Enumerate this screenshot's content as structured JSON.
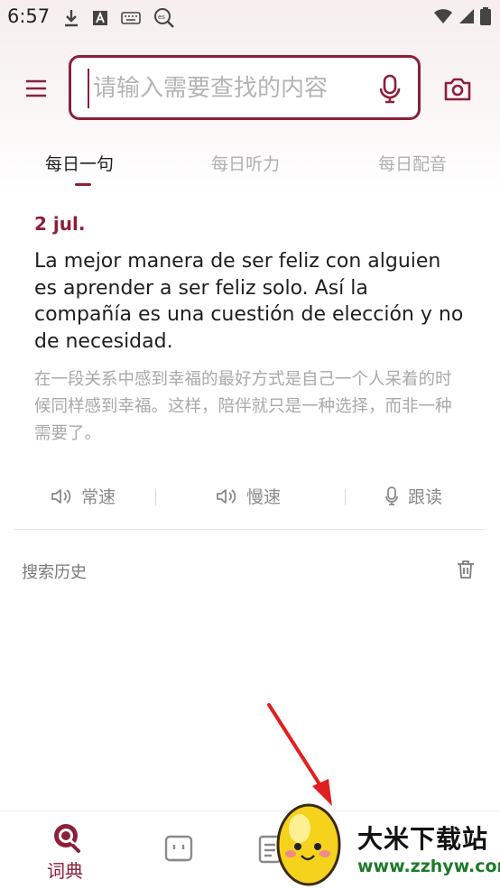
{
  "status_bar": {
    "time": "6:57",
    "icons": [
      "download-icon",
      "a-box-icon",
      "keyboard-icon",
      "es-search-icon",
      "wifi-icon",
      "signal-icon",
      "battery-icon"
    ]
  },
  "header": {
    "search_placeholder": "请输入需要查找的内容"
  },
  "tabs": [
    {
      "label": "每日一句",
      "active": true
    },
    {
      "label": "每日听力",
      "active": false
    },
    {
      "label": "每日配音",
      "active": false
    }
  ],
  "daily": {
    "date": "2 jul.",
    "sentence_es": "La mejor manera de ser feliz con alguien es aprender a ser feliz solo. Así la compañía es una cuestión de elección y no de necesidad.",
    "sentence_zh": "在一段关系中感到幸福的最好方式是自己一个人呆着的时候同样感到幸福。这样，陪伴就只是一种选择，而非一种需要了。",
    "audio": {
      "normal": "常速",
      "slow": "慢速",
      "follow": "跟读"
    }
  },
  "history": {
    "title": "搜索历史"
  },
  "bottom_nav": {
    "dictionary_label": "词典"
  },
  "watermark": {
    "title": "大米下载站",
    "url": "www.zzhyw.com"
  },
  "colors": {
    "accent": "#8c1f3a",
    "inactive_text": "#b0b0b0",
    "arrow": "#e02020"
  }
}
